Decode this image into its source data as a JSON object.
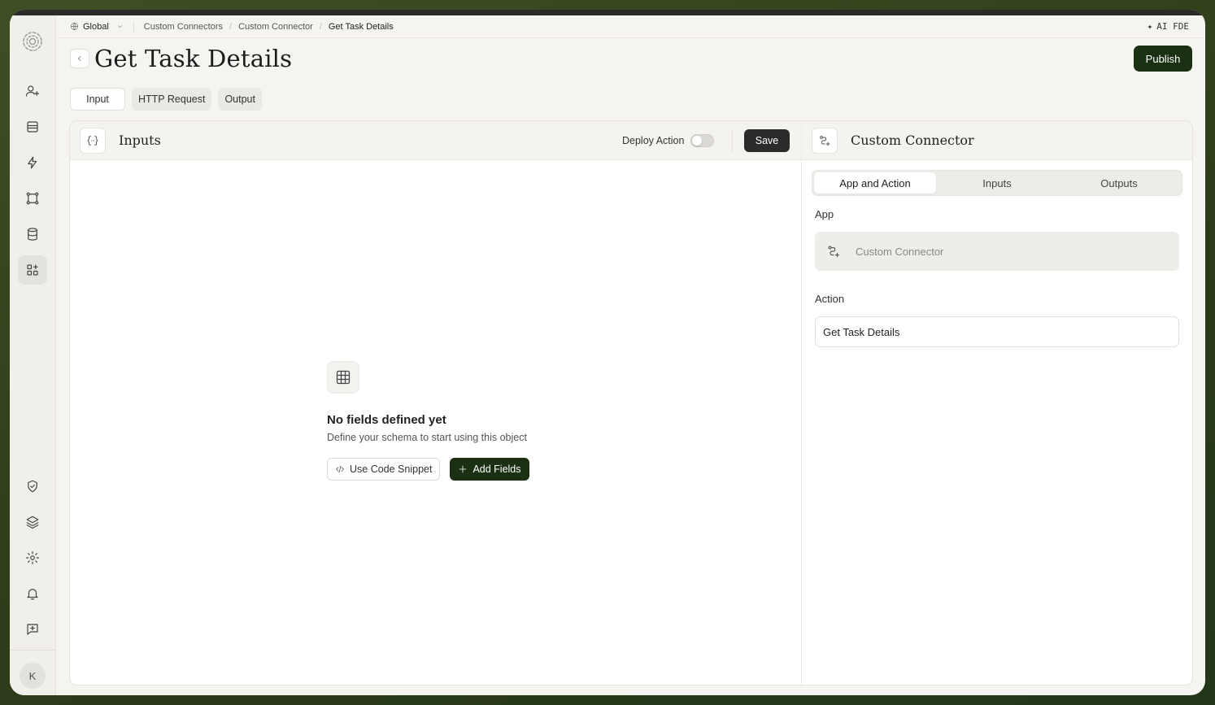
{
  "breadcrumb": {
    "workspace": "Global",
    "items": [
      "Custom Connectors",
      "Custom Connector",
      "Get Task Details"
    ]
  },
  "ai_label": "AI FDE",
  "page": {
    "title": "Get Task Details",
    "publish_label": "Publish"
  },
  "tabs": [
    {
      "label": "Input",
      "active": true
    },
    {
      "label": "HTTP Request",
      "active": false
    },
    {
      "label": "Output",
      "active": false
    }
  ],
  "inputs_pane": {
    "title": "Inputs",
    "deploy_label": "Deploy Action",
    "deploy_enabled": false,
    "save_label": "Save",
    "empty": {
      "title": "No fields defined yet",
      "subtitle": "Define your schema to start using this object",
      "snippet_label": "Use Code Snippet",
      "add_label": "Add Fields"
    }
  },
  "connector_pane": {
    "title": "Custom Connector",
    "segments": [
      {
        "label": "App and Action",
        "active": true
      },
      {
        "label": "Inputs",
        "active": false
      },
      {
        "label": "Outputs",
        "active": false
      }
    ],
    "app_label": "App",
    "app_value": "Custom Connector",
    "action_label": "Action",
    "action_value": "Get Task Details"
  },
  "sidebar": {
    "avatar_initial": "K",
    "top_icons": [
      "logo-icon",
      "user-plus-icon",
      "inbox-icon",
      "bolt-icon",
      "workflow-icon",
      "database-icon",
      "apps-icon"
    ],
    "bottom_icons": [
      "shield-icon",
      "layers-icon",
      "gear-icon",
      "bell-icon",
      "feedback-icon"
    ]
  },
  "colors": {
    "accent_dark_green": "#1b2f12",
    "background": "#f5f4f1"
  }
}
